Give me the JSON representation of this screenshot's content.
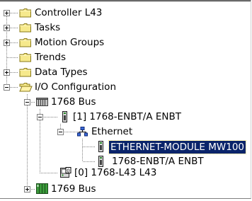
{
  "tree": {
    "controller": {
      "label": "Controller L43",
      "icon": "folder-icon",
      "state": "collapsed"
    },
    "tasks": {
      "label": "Tasks",
      "icon": "folder-icon",
      "state": "collapsed"
    },
    "motion_groups": {
      "label": "Motion Groups",
      "icon": "folder-icon",
      "state": "collapsed"
    },
    "trends": {
      "label": "Trends",
      "icon": "folder-icon",
      "state": "leaf"
    },
    "data_types": {
      "label": "Data Types",
      "icon": "folder-icon",
      "state": "collapsed"
    },
    "io_configuration": {
      "label": "I/O Configuration",
      "icon": "open-folder-icon",
      "state": "expanded"
    },
    "bus_1768": {
      "label": "1768 Bus",
      "icon": "backplane-icon",
      "state": "expanded"
    },
    "enbt_module": {
      "label": "[1] 1768-ENBT/A ENBT",
      "icon": "module-icon",
      "state": "expanded"
    },
    "ethernet": {
      "label": "Ethernet",
      "icon": "network-icon",
      "state": "expanded"
    },
    "ethernet_module": {
      "label": "ETHERNET-MODULE MW100",
      "icon": "module-icon",
      "state": "selected"
    },
    "enbt_child": {
      "label": "1768-ENBT/A ENBT",
      "icon": "module-icon",
      "state": "leaf"
    },
    "l43_controller": {
      "label": "[0] 1768-L43 L43",
      "icon": "controller-module-icon",
      "state": "leaf"
    },
    "bus_1769": {
      "label": "1769 Bus",
      "icon": "backplane-icon",
      "state": "collapsed"
    }
  },
  "colors": {
    "selection_bg": "#0a246a",
    "selection_text": "#ffffff",
    "folder_yellow": "#f6e98c",
    "folder_outline": "#8a7a1a"
  }
}
